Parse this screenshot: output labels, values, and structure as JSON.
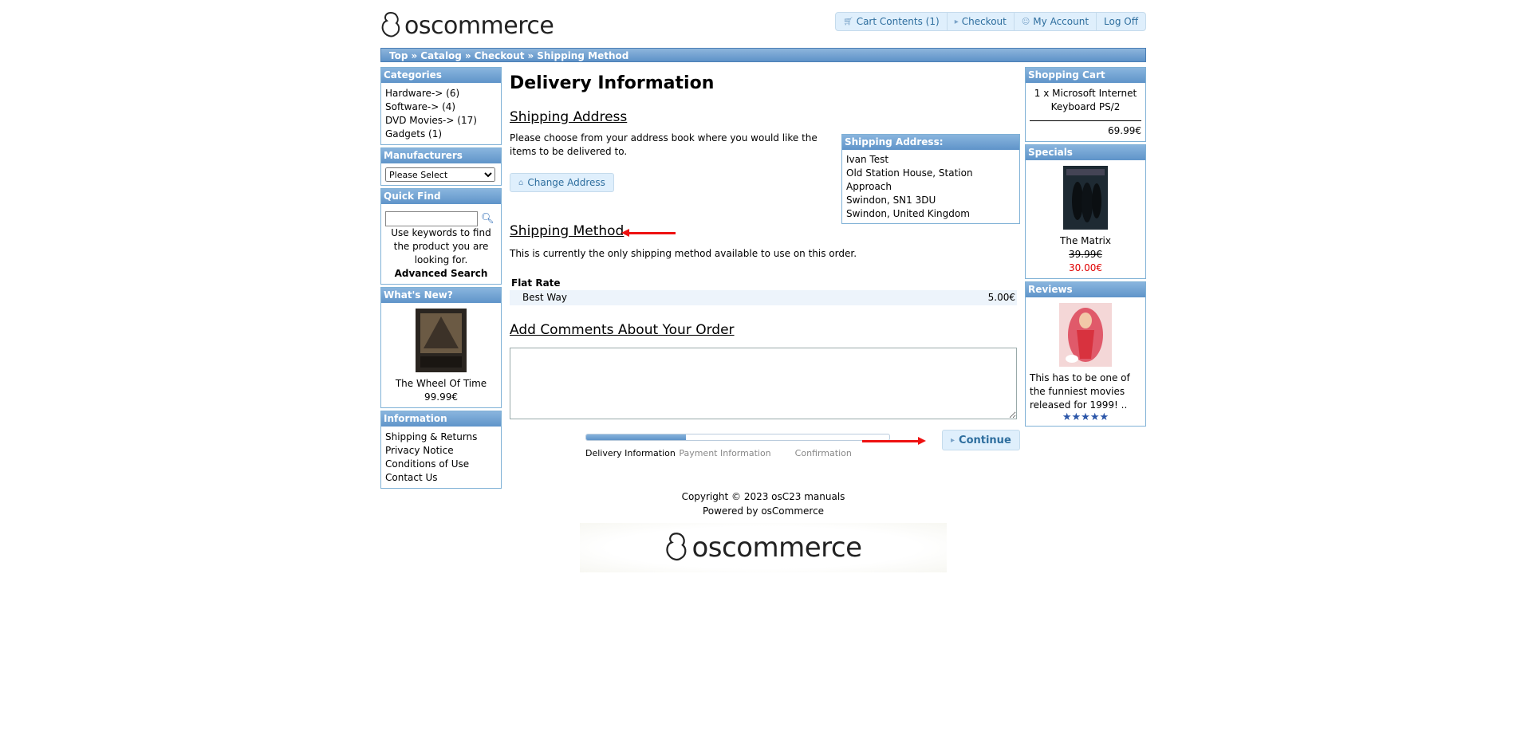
{
  "brand": {
    "name": "oscommerce"
  },
  "topnav": [
    {
      "label": "Cart Contents (1)",
      "icon": "cart-icon"
    },
    {
      "label": "Checkout",
      "icon": "triangle-right-icon"
    },
    {
      "label": "My Account",
      "icon": "person-icon"
    },
    {
      "label": "Log Off",
      "icon": ""
    }
  ],
  "breadcrumb": [
    "Top",
    "Catalog",
    "Checkout",
    "Shipping Method"
  ],
  "left": {
    "categories_title": "Categories",
    "categories": [
      "Hardware-> (6)",
      "Software-> (4)",
      "DVD Movies-> (17)",
      "Gadgets (1)"
    ],
    "manufacturers_title": "Manufacturers",
    "manufacturers_selected": "Please Select",
    "quickfind_title": "Quick Find",
    "quickfind_help": "Use keywords to find the product you are looking for.",
    "advanced_search": "Advanced Search",
    "whatsnew_title": "What's New?",
    "whatsnew_product": "The Wheel Of Time",
    "whatsnew_price": "99.99€",
    "information_title": "Information",
    "information": [
      "Shipping & Returns",
      "Privacy Notice",
      "Conditions of Use",
      "Contact Us"
    ]
  },
  "right": {
    "cart_title": "Shopping Cart",
    "cart_item": "1 x Microsoft Internet Keyboard PS/2",
    "cart_total": "69.99€",
    "specials_title": "Specials",
    "specials_product": "The Matrix",
    "specials_old_price": "39.99€",
    "specials_new_price": "30.00€",
    "reviews_title": "Reviews",
    "review_text": "This has to be one of the funniest movies released for 1999! ..",
    "review_stars": "★★★★★",
    "colors": {
      "special_price": "#e00000",
      "stars": "#2a55a8"
    }
  },
  "main": {
    "title": "Delivery Information",
    "shipping_address_heading": "Shipping Address",
    "shipping_address_text": "Please choose from your address book where you would like the items to be delivered to.",
    "change_address": "Change Address",
    "address_box_title": "Shipping Address:",
    "address_lines": [
      "Ivan Test",
      "Old Station House, Station Approach",
      "Swindon, SN1 3DU",
      "Swindon, United Kingdom"
    ],
    "shipping_method_heading": "Shipping Method",
    "shipping_method_text": "This is currently the only shipping method available to use on this order.",
    "rate_title": "Flat Rate",
    "rate_option": "Best Way",
    "rate_price": "5.00€",
    "comments_heading": "Add Comments About Your Order",
    "comments_value": "",
    "progress_fraction": 0.33,
    "steps": [
      "Delivery Information",
      "Payment Information",
      "Confirmation"
    ],
    "continue_label": "Continue"
  },
  "footer": {
    "copyright": "Copyright © 2023 osC23 manuals",
    "powered": "Powered by osCommerce"
  }
}
